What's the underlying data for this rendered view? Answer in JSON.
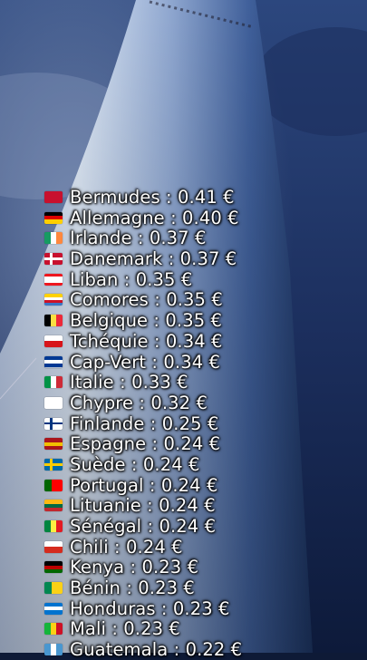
{
  "rates": [
    {
      "country": "Bermudes",
      "value": "0.41 €",
      "flag": {
        "kind": "solid",
        "colors": [
          "#c8102e"
        ]
      }
    },
    {
      "country": "Allemagne",
      "value": "0.40 €",
      "flag": {
        "kind": "h",
        "colors": [
          "#000000",
          "#dd0000",
          "#ffce00"
        ]
      }
    },
    {
      "country": "Irlande",
      "value": "0.37 €",
      "flag": {
        "kind": "v",
        "colors": [
          "#169b62",
          "#ffffff",
          "#ff883e"
        ]
      }
    },
    {
      "country": "Danemark",
      "value": "0.37 €",
      "flag": {
        "kind": "nordic",
        "colors": [
          "#c8102e",
          "#ffffff"
        ]
      }
    },
    {
      "country": "Liban",
      "value": "0.35 €",
      "flag": {
        "kind": "h3",
        "colors": [
          "#ee161f",
          "#ffffff",
          "#ee161f"
        ]
      }
    },
    {
      "country": "Comores",
      "value": "0.35 €",
      "flag": {
        "kind": "h4",
        "colors": [
          "#ffd100",
          "#ffffff",
          "#ce1126",
          "#3a75c4"
        ]
      }
    },
    {
      "country": "Belgique",
      "value": "0.35 €",
      "flag": {
        "kind": "v",
        "colors": [
          "#000000",
          "#fae042",
          "#ed2939"
        ]
      }
    },
    {
      "country": "Tchéquie",
      "value": "0.34 €",
      "flag": {
        "kind": "h2",
        "colors": [
          "#ffffff",
          "#d7141a"
        ]
      }
    },
    {
      "country": "Cap-Vert",
      "value": "0.34 €",
      "flag": {
        "kind": "h",
        "colors": [
          "#003893",
          "#ffffff",
          "#003893"
        ]
      }
    },
    {
      "country": "Italie",
      "value": "0.33 €",
      "flag": {
        "kind": "v",
        "colors": [
          "#009246",
          "#ffffff",
          "#ce2b37"
        ]
      }
    },
    {
      "country": "Chypre",
      "value": "0.32 €",
      "flag": {
        "kind": "solid",
        "colors": [
          "#ffffff"
        ]
      }
    },
    {
      "country": "Finlande",
      "value": "0.25 €",
      "flag": {
        "kind": "nordic",
        "colors": [
          "#ffffff",
          "#003580"
        ]
      }
    },
    {
      "country": "Espagne",
      "value": "0.24 €",
      "flag": {
        "kind": "h",
        "colors": [
          "#aa151b",
          "#f1bf00",
          "#aa151b"
        ]
      }
    },
    {
      "country": "Suède",
      "value": "0.24 €",
      "flag": {
        "kind": "nordic",
        "colors": [
          "#006aa7",
          "#fecc00"
        ]
      }
    },
    {
      "country": "Portugal",
      "value": "0.24 €",
      "flag": {
        "kind": "v2",
        "colors": [
          "#006600",
          "#ff0000"
        ]
      }
    },
    {
      "country": "Lituanie",
      "value": "0.24 €",
      "flag": {
        "kind": "h",
        "colors": [
          "#fdb913",
          "#006a44",
          "#c1272d"
        ]
      }
    },
    {
      "country": "Sénégal",
      "value": "0.24 €",
      "flag": {
        "kind": "v",
        "colors": [
          "#00853f",
          "#fdef42",
          "#e31b23"
        ]
      }
    },
    {
      "country": "Chili",
      "value": "0.24 €",
      "flag": {
        "kind": "h2",
        "colors": [
          "#ffffff",
          "#d52b1e"
        ]
      }
    },
    {
      "country": "Kenya",
      "value": "0.23 €",
      "flag": {
        "kind": "h",
        "colors": [
          "#000000",
          "#bb0000",
          "#006600"
        ]
      }
    },
    {
      "country": "Bénin",
      "value": "0.23 €",
      "flag": {
        "kind": "v2",
        "colors": [
          "#008751",
          "#fcd116"
        ]
      }
    },
    {
      "country": "Honduras",
      "value": "0.23 €",
      "flag": {
        "kind": "h",
        "colors": [
          "#0073cf",
          "#ffffff",
          "#0073cf"
        ]
      }
    },
    {
      "country": "Mali",
      "value": "0.23 €",
      "flag": {
        "kind": "v",
        "colors": [
          "#14b53a",
          "#fcd116",
          "#ce1126"
        ]
      }
    },
    {
      "country": "Guatemala",
      "value": "0.22 €",
      "flag": {
        "kind": "v",
        "colors": [
          "#4997d0",
          "#ffffff",
          "#4997d0"
        ]
      }
    }
  ]
}
